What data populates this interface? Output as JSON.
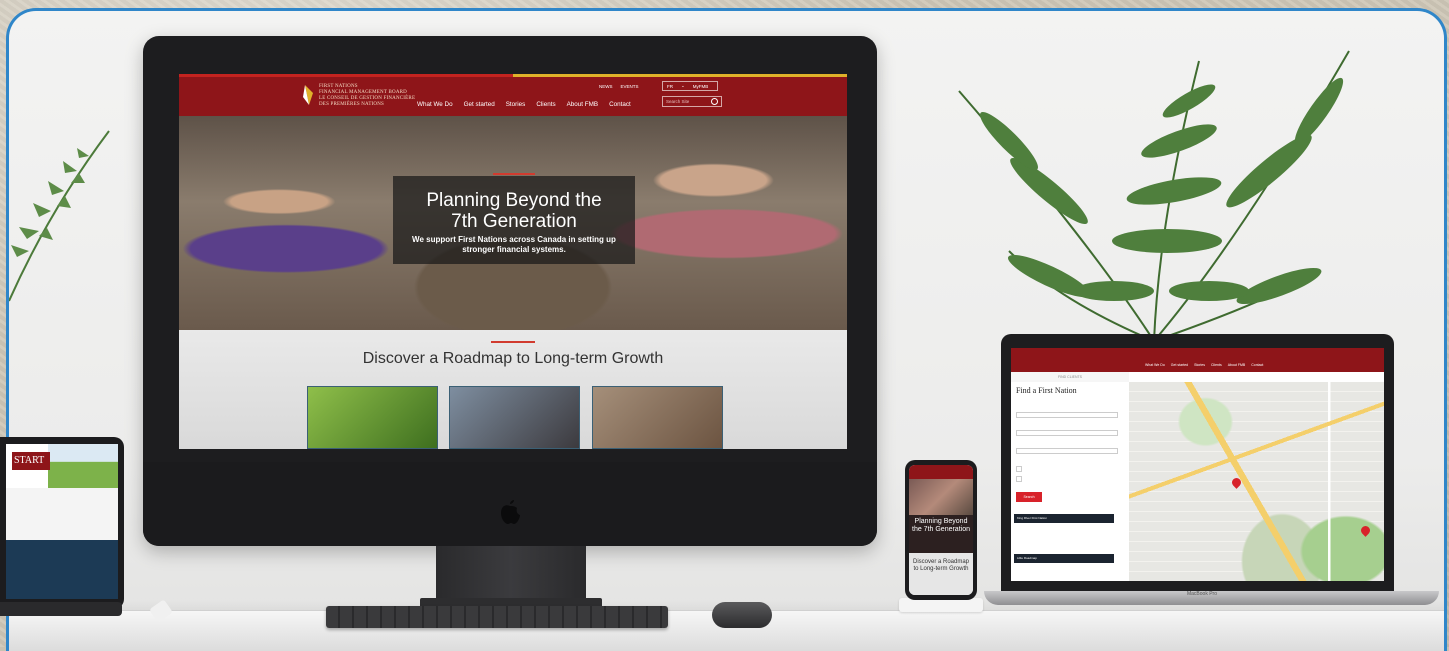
{
  "imac_site": {
    "logo_lines": [
      "FIRST NATIONS",
      "FINANCIAL MANAGEMENT BOARD",
      "LE CONSEIL DE GESTION FINANCIÈRE",
      "DES PREMIÈRES NATIONS"
    ],
    "utility_links": [
      "NEWS",
      "EVENTS"
    ],
    "language_selector": "FR",
    "account_link": "MyFMB",
    "search_placeholder": "Search Site",
    "nav": [
      "What We Do",
      "Get started",
      "Stories",
      "Clients",
      "About FMB",
      "Contact"
    ],
    "hero_title_line1": "Planning Beyond the",
    "hero_title_line2": "7th Generation",
    "hero_subtitle_line1": "We support First Nations across Canada in setting up",
    "hero_subtitle_line2": "stronger financial systems.",
    "discover_title": "Discover a Roadmap to Long-term Growth"
  },
  "ipad_site": {
    "badge": "START"
  },
  "phone_site": {
    "hero_title_line1": "Planning Beyond",
    "hero_title_line2": "the 7th Generation",
    "discover_line1": "Discover a Roadmap",
    "discover_line2": "to Long-term Growth"
  },
  "laptop_site": {
    "nav": [
      "What We Do",
      "Get started",
      "Stories",
      "Clients",
      "About FMB",
      "Contact"
    ],
    "subheader": "FIND CLIENTS",
    "page_title": "Find a First Nation",
    "search_button": "Search",
    "result_cards": [
      "King River First Nation",
      "Lillie Roadmap"
    ],
    "laptop_label": "MacBook Pro"
  },
  "colors": {
    "brand_red": "#8e1519",
    "accent_red": "#d13b2f",
    "accent_gold": "#e0b12a",
    "border_blue": "#2f86c9"
  }
}
